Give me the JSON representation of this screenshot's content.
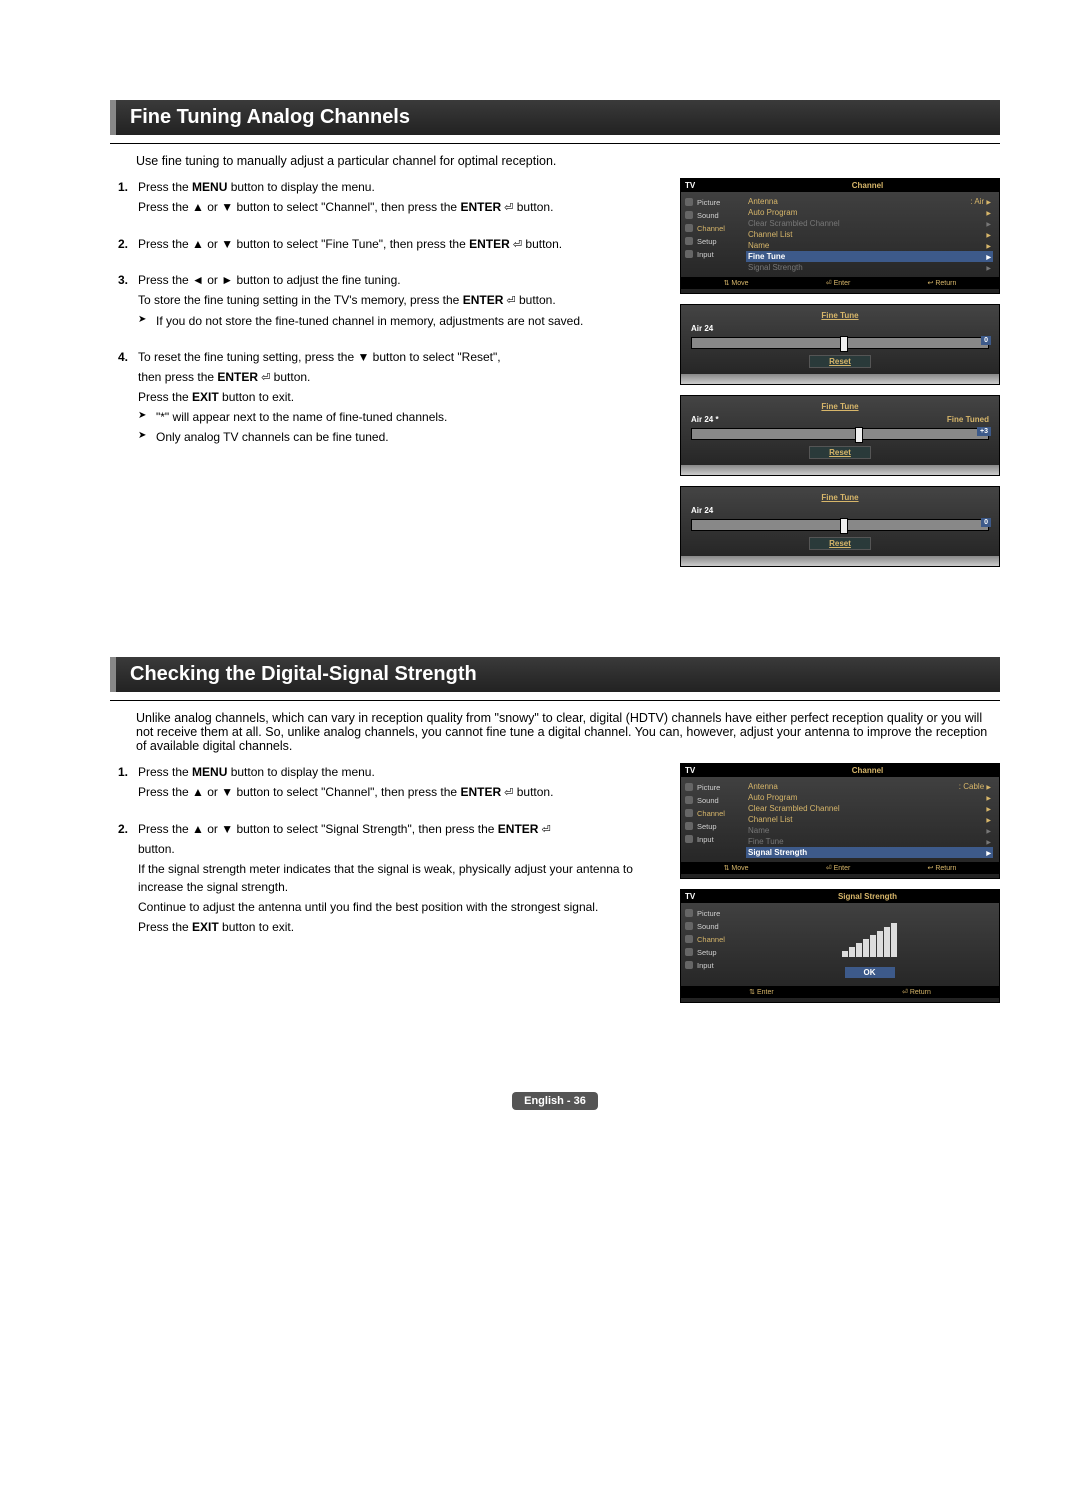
{
  "section1": {
    "title": "Fine Tuning Analog Channels",
    "intro": "Use fine tuning to manually adjust a particular channel for optimal reception.",
    "steps": [
      {
        "num": "1.",
        "lines": [
          {
            "pre": "Press the ",
            "b": "MENU",
            "post": " button to display the menu."
          },
          {
            "pre": "Press the ▲ or ▼ button to select \"Channel\", then press the ",
            "enter": "ENTER",
            "post": " button."
          }
        ]
      },
      {
        "num": "2.",
        "lines": [
          {
            "pre": "Press the ▲ or ▼ button to select \"Fine Tune\", then press the ",
            "enter": "ENTER",
            "post": " button."
          }
        ]
      },
      {
        "num": "3.",
        "lines": [
          {
            "pre": "Press the ◄ or ► button to adjust the fine tuning.",
            "b": "",
            "post": ""
          },
          {
            "pre": "To store the fine tuning setting in the TV's memory, press the ",
            "enter": "ENTER",
            "post": " button."
          }
        ],
        "notes": [
          "If you do not store the fine-tuned channel in memory, adjustments are not saved."
        ]
      },
      {
        "num": "4.",
        "lines": [
          {
            "pre": "To reset the fine tuning setting, press the ▼ button to select \"Reset\",",
            "b": "",
            "post": ""
          },
          {
            "pre": "then press  the ",
            "enter": "ENTER",
            "post": " button."
          },
          {
            "pre": "Press the ",
            "b": "EXIT",
            "post": " button to exit."
          }
        ],
        "notes": [
          "\"*\" will appear next to the name of fine-tuned channels.",
          "Only analog TV channels can be fine tuned."
        ]
      }
    ]
  },
  "section2": {
    "title": "Checking the Digital-Signal Strength",
    "intro": "Unlike analog channels, which can vary in reception quality from \"snowy\" to clear, digital (HDTV) channels have either perfect reception quality or you will not receive them at all. So, unlike analog channels, you cannot fine tune a digital channel. You can, however, adjust your antenna to improve the reception of available digital channels.",
    "steps": [
      {
        "num": "1.",
        "lines": [
          {
            "pre": "Press the ",
            "b": "MENU",
            "post": " button to display the menu."
          },
          {
            "pre": "Press the ▲ or ▼ button to select \"Channel\", then press the ",
            "enter": "ENTER",
            "post": " button."
          }
        ]
      },
      {
        "num": "2.",
        "lines": [
          {
            "pre": "Press the ▲ or ▼ button to select \"Signal Strength\", then press the ",
            "enter": "ENTER",
            "post": ""
          },
          {
            "pre": "button.",
            "b": "",
            "post": ""
          },
          {
            "pre": "If the signal strength meter indicates that the signal is weak, physically adjust your antenna to increase the signal strength.",
            "b": "",
            "post": ""
          },
          {
            "pre": "Continue to adjust the antenna until you find the best position with the strongest signal.",
            "b": "",
            "post": ""
          },
          {
            "pre": "Press the ",
            "b": "EXIT",
            "post": " button to exit."
          }
        ]
      }
    ]
  },
  "tv1": {
    "label": "TV",
    "title": "Channel",
    "side": [
      "Picture",
      "Sound",
      "Channel",
      "Setup",
      "Input"
    ],
    "rows": [
      {
        "l": "Antenna",
        "r": ": Air",
        "dim": false
      },
      {
        "l": "Auto Program",
        "r": "",
        "dim": false
      },
      {
        "l": "Clear Scrambled Channel",
        "r": "",
        "dim": true
      },
      {
        "l": "Channel List",
        "r": "",
        "dim": false
      },
      {
        "l": "Name",
        "r": "",
        "dim": false
      },
      {
        "l": "Fine Tune",
        "r": "",
        "hi": true
      },
      {
        "l": "Signal Strength",
        "r": "",
        "dim": true
      }
    ],
    "foot": [
      "Move",
      "Enter",
      "Return"
    ]
  },
  "ft_panels": [
    {
      "title": "Fine Tune",
      "ch": "Air 24",
      "status": "",
      "pos": 50,
      "val": "0",
      "reset": "Reset"
    },
    {
      "title": "Fine Tune",
      "ch": "Air 24 *",
      "status": "Fine Tuned",
      "pos": 55,
      "val": "+3",
      "reset": "Reset"
    },
    {
      "title": "Fine Tune",
      "ch": "Air 24",
      "status": "",
      "pos": 50,
      "val": "0",
      "reset": "Reset"
    }
  ],
  "tv2": {
    "label": "TV",
    "title": "Channel",
    "side": [
      "Picture",
      "Sound",
      "Channel",
      "Setup",
      "Input"
    ],
    "rows": [
      {
        "l": "Antenna",
        "r": ": Cable",
        "dim": false
      },
      {
        "l": "Auto Program",
        "r": "",
        "dim": false
      },
      {
        "l": "Clear Scrambled Channel",
        "r": "",
        "dim": false
      },
      {
        "l": "Channel List",
        "r": "",
        "dim": false
      },
      {
        "l": "Name",
        "r": "",
        "dim": true
      },
      {
        "l": "Fine Tune",
        "r": "",
        "dim": true
      },
      {
        "l": "Signal Strength",
        "r": "",
        "hi": true
      }
    ],
    "foot": [
      "Move",
      "Enter",
      "Return"
    ]
  },
  "tv3": {
    "label": "TV",
    "title": "Signal Strength",
    "side": [
      "Picture",
      "Sound",
      "Channel",
      "Setup",
      "Input"
    ],
    "ok": "OK",
    "foot": [
      "Enter",
      "Return"
    ]
  },
  "footer": "English - 36"
}
